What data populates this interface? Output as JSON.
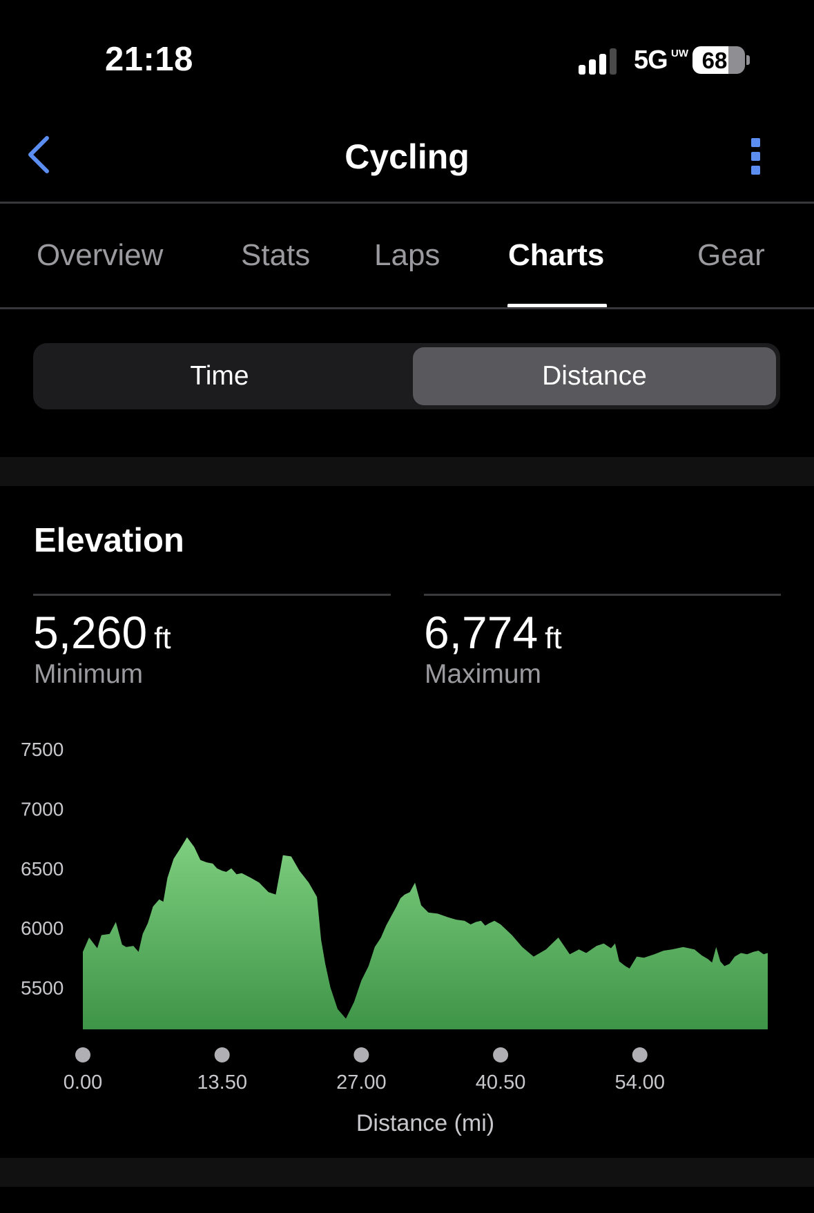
{
  "status_bar": {
    "time": "21:18",
    "network": "5G",
    "network_superscript": "UW",
    "battery_percent": "68",
    "battery_level": 0.68,
    "signal_bars_filled": 3,
    "signal_bars_total": 4
  },
  "nav": {
    "back_icon": "chevron-left-icon",
    "title": "Cycling",
    "more_icon": "more-vertical-icon",
    "accent_color": "#5b8ef0"
  },
  "tabs": [
    {
      "label": "Overview",
      "active": false
    },
    {
      "label": "Stats",
      "active": false
    },
    {
      "label": "Laps",
      "active": false
    },
    {
      "label": "Charts",
      "active": true
    },
    {
      "label": "Gear",
      "active": false
    }
  ],
  "segment": {
    "options": [
      "Time",
      "Distance"
    ],
    "selected": "Distance"
  },
  "elevation": {
    "title": "Elevation",
    "minimum": {
      "value": "5,260",
      "unit": "ft",
      "label": "Minimum"
    },
    "maximum": {
      "value": "6,774",
      "unit": "ft",
      "label": "Maximum"
    }
  },
  "chart_data": {
    "type": "area",
    "xlabel": "Distance (mi)",
    "ylabel": "",
    "ylim": [
      5150,
      7500
    ],
    "xlim": [
      0,
      66.4
    ],
    "y_ticks": [
      5500,
      6000,
      6500,
      7000,
      7500
    ],
    "x_ticks": [
      0.0,
      13.5,
      27.0,
      40.5,
      54.0
    ],
    "x_tick_labels": [
      "0.00",
      "13.50",
      "27.00",
      "40.50",
      "54.00"
    ],
    "fill_color_top": "#7fcf80",
    "fill_color_bottom": "#3e9447",
    "grid": false,
    "series": [
      {
        "x": [
          0.0,
          0.6,
          1.4,
          1.8,
          2.6,
          3.2,
          3.8,
          4.2,
          4.9,
          5.4,
          5.8,
          6.3,
          6.8,
          7.4,
          7.8,
          8.2,
          8.8,
          9.4,
          10.1,
          10.8,
          11.4,
          12.0,
          12.6,
          13.0,
          13.5,
          13.9,
          14.4,
          14.9,
          15.4,
          16.3,
          17.1,
          18.0,
          18.7,
          19.4,
          20.2,
          21.0,
          21.9,
          22.7,
          23.1,
          23.5,
          24.0,
          24.7,
          25.5,
          26.3,
          27.0,
          27.7,
          28.3,
          28.9,
          29.4,
          29.9,
          30.4,
          30.8,
          31.2,
          31.7,
          32.2,
          32.8,
          33.5,
          34.4,
          35.4,
          36.2,
          37.0,
          37.6,
          38.1,
          38.6,
          39.0,
          39.4,
          39.9,
          40.5,
          41.6,
          42.6,
          43.7,
          44.9,
          46.1,
          47.2,
          48.1,
          48.8,
          49.8,
          50.5,
          51.2,
          51.6,
          52.0,
          52.6,
          53.0,
          53.7,
          54.4,
          55.4,
          56.3,
          57.1,
          58.2,
          59.3,
          60.0,
          60.6,
          61.0,
          61.4,
          61.8,
          62.2,
          62.7,
          63.2,
          63.8,
          64.4,
          65.0,
          65.5,
          66.0,
          66.4
        ],
        "y": [
          5800,
          5920,
          5830,
          5940,
          5950,
          6050,
          5860,
          5840,
          5850,
          5800,
          5950,
          6040,
          6180,
          6240,
          6220,
          6420,
          6580,
          6660,
          6760,
          6680,
          6570,
          6550,
          6540,
          6500,
          6480,
          6470,
          6500,
          6450,
          6460,
          6420,
          6380,
          6300,
          6280,
          6610,
          6600,
          6480,
          6380,
          6260,
          5900,
          5700,
          5500,
          5320,
          5240,
          5380,
          5560,
          5680,
          5840,
          5920,
          6020,
          6100,
          6180,
          6250,
          6280,
          6300,
          6380,
          6190,
          6130,
          6120,
          6090,
          6070,
          6060,
          6030,
          6050,
          6060,
          6020,
          6040,
          6060,
          6030,
          5940,
          5840,
          5760,
          5820,
          5920,
          5780,
          5820,
          5790,
          5850,
          5870,
          5830,
          5870,
          5720,
          5680,
          5660,
          5760,
          5750,
          5780,
          5810,
          5820,
          5840,
          5820,
          5770,
          5740,
          5710,
          5840,
          5720,
          5680,
          5700,
          5760,
          5790,
          5780,
          5800,
          5810,
          5780,
          5790
        ]
      }
    ]
  }
}
